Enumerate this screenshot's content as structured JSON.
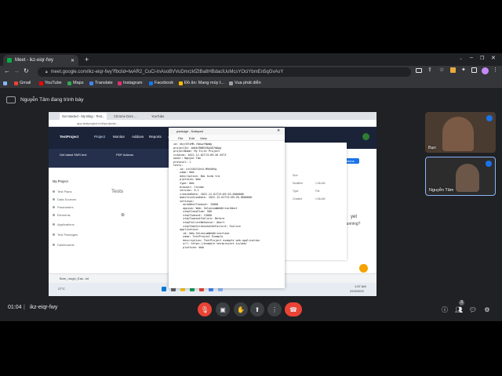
{
  "browser": {
    "tab_title": "Meet - ikz-eiqr-fwy",
    "url": "meet.google.com/ikz-eiqr-fwy?fbclid=IwAR2_CuCi-tnAsoBVVuDmrzkfZtBa8HBdaclUuMcsYOciYbmEn5qGvAsY",
    "bookmarks": [
      "Gmail",
      "YouTube",
      "Maps",
      "Translate",
      "Instagram",
      "Facebook",
      "Đồ ăn: Mang mùy t...",
      "Vua phát diễn"
    ]
  },
  "meet": {
    "presenter_label": "Nguyễn Tâm đang trình bày",
    "meeting_time": "01:04",
    "meeting_code": "ikz-eiqr-fwy",
    "people_count": "3",
    "participants": [
      {
        "name": "Bạn"
      },
      {
        "name": "Nguyễn Tâm"
      }
    ],
    "colors": {
      "end_call": "#ea4335",
      "mic_off": "#ea4335",
      "active_tile": "#8ab4f8"
    }
  },
  "shared_screen": {
    "tabs": [
      "Get started - My Blog - Test...",
      "Chrome Dom ...",
      "YouTube"
    ],
    "app_url": "app.testproject.io/#/projects/...",
    "logo": "TestProject",
    "nav": [
      "Project",
      "Monitor",
      "Addons",
      "Reports",
      "Agents",
      "Inte..."
    ],
    "promo_left": "Get latest SMS text",
    "promo_right": "PDF Actions",
    "project_label": "My Project",
    "tests_title": "Tests",
    "side_items": [
      "Test Plans",
      "Data Sources",
      "Parameters",
      "Elements",
      "Applications",
      "Test Packages",
      "Dashboards"
    ],
    "right_text": "yet",
    "right_text2": "running?",
    "addons_btn": "Addons",
    "taskbar_search": "Bom_rough_Eas...txt",
    "taskbar_weather": "27°C",
    "taskbar_time": "1:57 AM",
    "taskbar_date": "22/3/2022"
  },
  "notepad": {
    "title": "package - Notepad",
    "menu": [
      "File",
      "Edit",
      "View"
    ],
    "lines": [
      "id: ebjr07xMR-r6mwvYWpWg",
      "projectId: dd0kY8WRCEKpG07m8gg",
      "projectName: My First Project",
      "created: 2022-12-01T13:09:26.597Z",
      "owner: Nguyen Tam",
      "protocol: 1",
      "tests:",
      "  - id: krCh3O7xOrO-M9hUHVg",
      "    name: Web",
      "    description: Bai kiem tra",
      "    platform: Web",
      "    type: Web",
      "    browser: Chrome",
      "    version: 0.1",
      "    createdDate: 2022-12-01T13:09:26.0000000",
      "    modificationDate: 2022-12-01T13:09:26.0000000",
      "    settings:",
      "      autoWaitTimeout: 15000",
      "      appium: Web: SeleniumWebDriverWait",
      "      stepSleepTime: 500",
      "      stepTimeout: 15000",
      "      stepTimeoutFailure: Before",
      "      stepFailureBehavior: Abort",
      "      stepTakeScreenshotOnFailure: Failure",
      "    application:",
      "      id: Web-SeleniumWebDriverCase",
      "      name: TestProject Example",
      "      description: TestProject example web application",
      "      url: https://example.testproject.io/web/",
      "      platform: Web"
    ],
    "explorer_side": [
      "Quick access",
      "Desktop",
      "Downloads",
      "Documents",
      "Pictures",
      "Music",
      "Videos",
      "OneDrive",
      "This PC",
      "Network"
    ],
    "props": [
      {
        "k": "Size",
        "v": ""
      },
      {
        "k": "Modified",
        "v": "1:56 AM"
      },
      {
        "k": "Type",
        "v": "File"
      },
      {
        "k": "Created",
        "v": "1:56 AM"
      }
    ]
  }
}
